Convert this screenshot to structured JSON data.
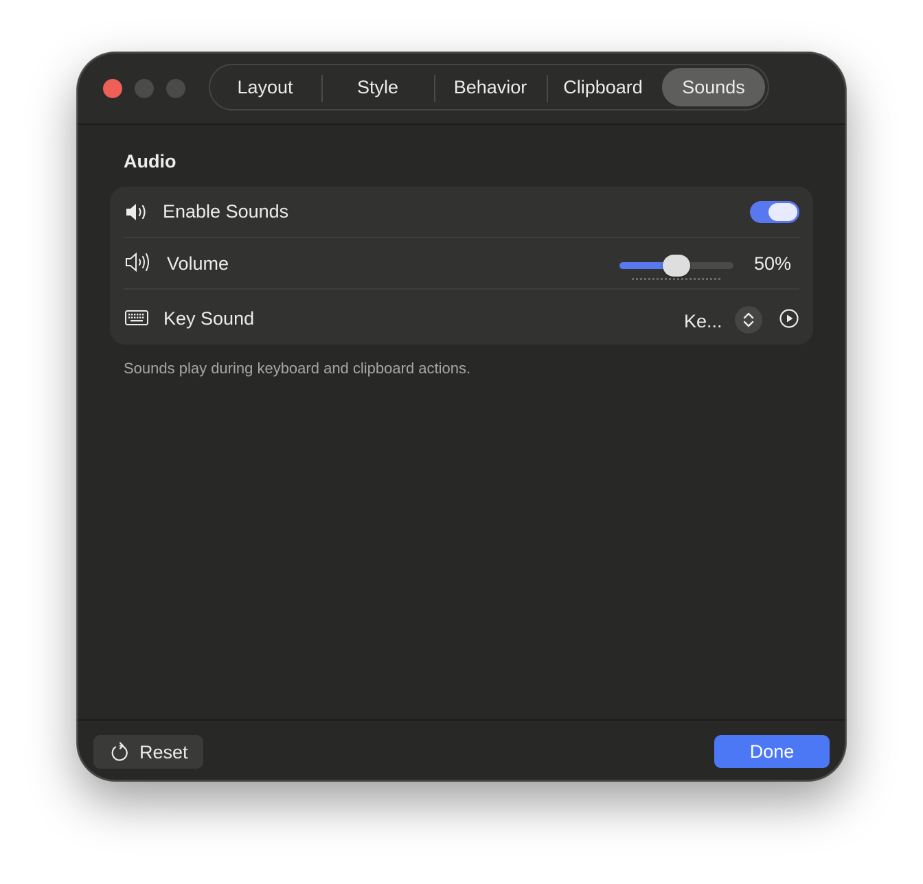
{
  "window": {
    "tabs": [
      {
        "label": "Layout",
        "active": false
      },
      {
        "label": "Style",
        "active": false
      },
      {
        "label": "Behavior",
        "active": false
      },
      {
        "label": "Clipboard",
        "active": false
      },
      {
        "label": "Sounds",
        "active": true
      }
    ]
  },
  "audio": {
    "section_title": "Audio",
    "enable_sounds": {
      "label": "Enable Sounds",
      "enabled": true,
      "icon": "speaker-icon"
    },
    "volume": {
      "label": "Volume",
      "value_text": "50%",
      "level": 0.5,
      "icon": "speaker-wave-icon"
    },
    "key_sound": {
      "label": "Key Sound",
      "selected": "Ke...",
      "icon": "keyboard-icon"
    },
    "footnote": "Sounds play during keyboard and clipboard actions."
  },
  "footer": {
    "reset_label": "Reset",
    "done_label": "Done"
  },
  "colors": {
    "accent": "#5878f0",
    "done_button": "#4c78f5",
    "window_bg": "#282827",
    "card_bg": "#323231",
    "close_button": "#ee5f57"
  }
}
